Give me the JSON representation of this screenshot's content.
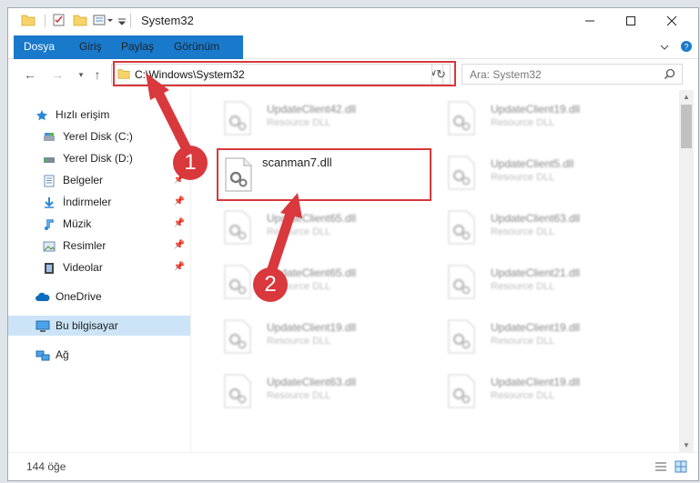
{
  "window": {
    "title": "System32",
    "controls": {
      "minimize": "minimize-icon",
      "maximize": "maximize-icon",
      "close": "close-icon"
    }
  },
  "ribbon": {
    "tabs": [
      "Dosya",
      "Giriş",
      "Paylaş",
      "Görünüm"
    ]
  },
  "address": {
    "path": "C:\\Windows\\System32",
    "search_placeholder": "Ara: System32"
  },
  "nav": {
    "items": [
      {
        "label": "Hızlı erişim",
        "icon": "star-icon"
      },
      {
        "label": "Yerel Disk (C:)",
        "icon": "drive-icon"
      },
      {
        "label": "Yerel Disk (D:)",
        "icon": "drive-icon"
      },
      {
        "label": "Belgeler",
        "icon": "documents-icon"
      },
      {
        "label": "İndirmeler",
        "icon": "download-icon"
      },
      {
        "label": "Müzik",
        "icon": "music-icon"
      },
      {
        "label": "Resimler",
        "icon": "pictures-icon"
      },
      {
        "label": "Videolar",
        "icon": "video-icon"
      },
      {
        "label": "OneDrive",
        "icon": "cloud-icon"
      },
      {
        "label": "Bu bilgisayar",
        "icon": "computer-icon"
      },
      {
        "label": "Ağ",
        "icon": "network-icon"
      }
    ]
  },
  "files": [
    {
      "name": "UpdateClient42.dll",
      "type": "Resource DLL"
    },
    {
      "name": "UpdateClient19.dll",
      "type": "Resource DLL"
    },
    {
      "name": "scanman7.dll",
      "type": ""
    },
    {
      "name": "UpdateClient5.dll",
      "type": "Resource DLL"
    },
    {
      "name": "UpdateClient65.dll",
      "type": "Resource DLL"
    },
    {
      "name": "UpdateClient63.dll",
      "type": "Resource DLL"
    },
    {
      "name": "UpdateClient65.dll",
      "type": "Resource DLL"
    },
    {
      "name": "UpdateClient21.dll",
      "type": "Resource DLL"
    },
    {
      "name": "UpdateClient19.dll",
      "type": "Resource DLL"
    },
    {
      "name": "UpdateClient19.dll",
      "type": "Resource DLL"
    },
    {
      "name": "UpdateClient63.dll",
      "type": "Resource DLL"
    },
    {
      "name": "UpdateClient19.dll",
      "type": "Resource DLL"
    }
  ],
  "status": {
    "item_count": "144 öğe"
  },
  "annotations": {
    "step1": "1",
    "step2": "2",
    "color": "#d9383d"
  }
}
